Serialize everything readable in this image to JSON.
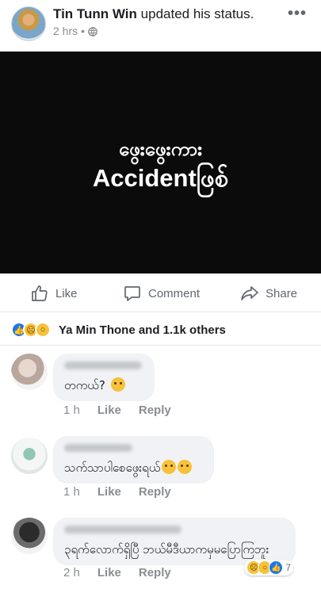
{
  "post": {
    "author": "Tin Tunn Win",
    "action": "updated his status.",
    "time": "2 hrs",
    "separator": "•",
    "privacy_icon": "globe-icon",
    "more_icon": "ellipsis-icon",
    "more_label": "•••"
  },
  "image": {
    "line1": "ဖွေးဖွေးကား",
    "line2": "Accidentဖြစ်"
  },
  "actions": {
    "like": "Like",
    "comment": "Comment",
    "share": "Share"
  },
  "reactions": {
    "summary": "Ya Min Thone and 1.1k others",
    "icons": [
      "like-icon",
      "sad-icon",
      "wow-icon"
    ]
  },
  "comments": [
    {
      "text": "တကယ်?",
      "time": "1 h",
      "like": "Like",
      "reply": "Reply"
    },
    {
      "text": "သက်သာပါစေဖွေးရယ်",
      "time": "1 h",
      "like": "Like",
      "reply": "Reply"
    },
    {
      "text": "၃ရက်လောက်ရှိပြီ ဘယ်မီဒီယာကမှမပြောကြဘူး",
      "time": "2 h",
      "like": "Like",
      "reply": "Reply",
      "reaction_count": "7"
    }
  ],
  "colors": {
    "accent": "#1877f2",
    "meta": "#8a8d91",
    "bubble": "#f0f2f5",
    "image_bg": "#0b0b0b"
  }
}
